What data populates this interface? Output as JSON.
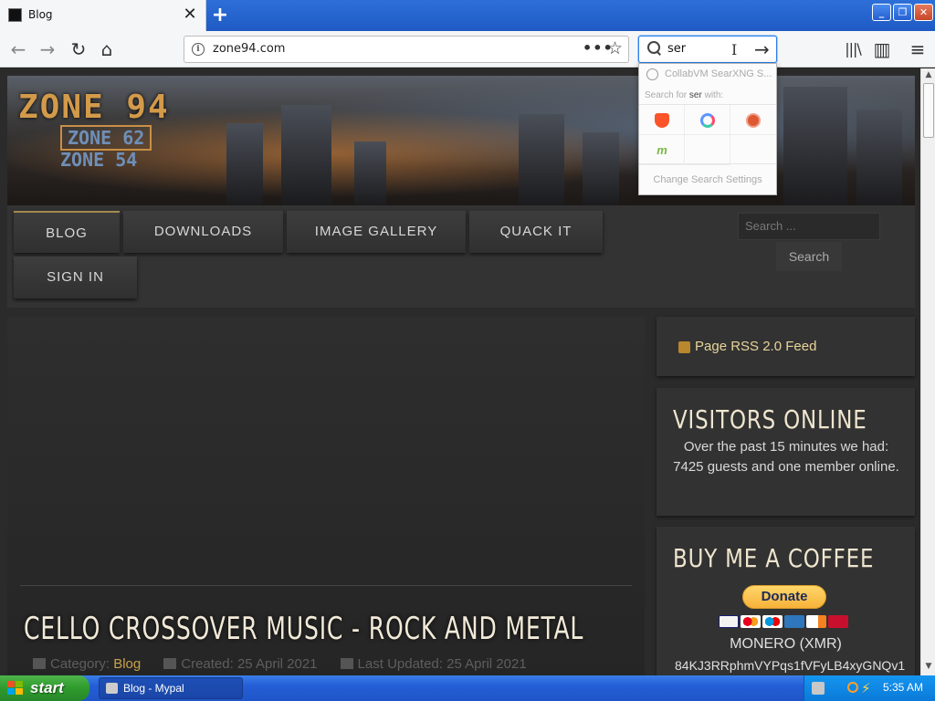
{
  "browser": {
    "tab_title": "Blog",
    "url": "zone94.com",
    "search_query": "ser"
  },
  "search_popup": {
    "engine_label": "CollabVM SearXNG S...",
    "hint_prefix": "Search for ",
    "hint_query": "ser",
    "hint_suffix": " with:",
    "engines": [
      "brave-icon",
      "qwant-icon",
      "duckduckgo-icon",
      "mojeek-icon"
    ],
    "mojeek_glyph": "m",
    "settings_label": "Change Search Settings"
  },
  "site": {
    "logo_main": "ZONE 94",
    "logo_sub1": "ZONE 62",
    "logo_sub2": "ZONE 54",
    "menu": {
      "blog": "BLOG",
      "downloads": "DOWNLOADS",
      "gallery": "IMAGE GALLERY",
      "quack": "QUACK IT",
      "signin": "SIGN IN"
    },
    "search_placeholder": "Search ...",
    "search_button": "Search"
  },
  "article": {
    "title": "CELLO CROSSOVER MUSIC - ROCK AND METAL",
    "category_label": "Category: ",
    "category_value": "Blog",
    "created": "Created: 25 April 2021",
    "updated": "Last Updated: 25 April 2021"
  },
  "sidebar": {
    "rss_label": "Page RSS 2.0 Feed",
    "visitors_heading": "VISITORS ONLINE",
    "visitors_text": "Over the past 15 minutes we had: 7425 guests and one member online.",
    "coffee_heading": "BUY ME A COFFEE",
    "donate_label": "Donate",
    "monero_label": "MONERO (XMR)",
    "monero_address": "84KJ3RRphmVYPqs1fVFyLB4xyGNQv1"
  },
  "taskbar": {
    "start_label": "start",
    "task_label": "Blog - Mypal",
    "clock": "5:35 AM"
  },
  "colors": {
    "accent": "#c9a24a",
    "taskbar_blue": "#245ed6",
    "start_green": "#2f9a2c"
  }
}
